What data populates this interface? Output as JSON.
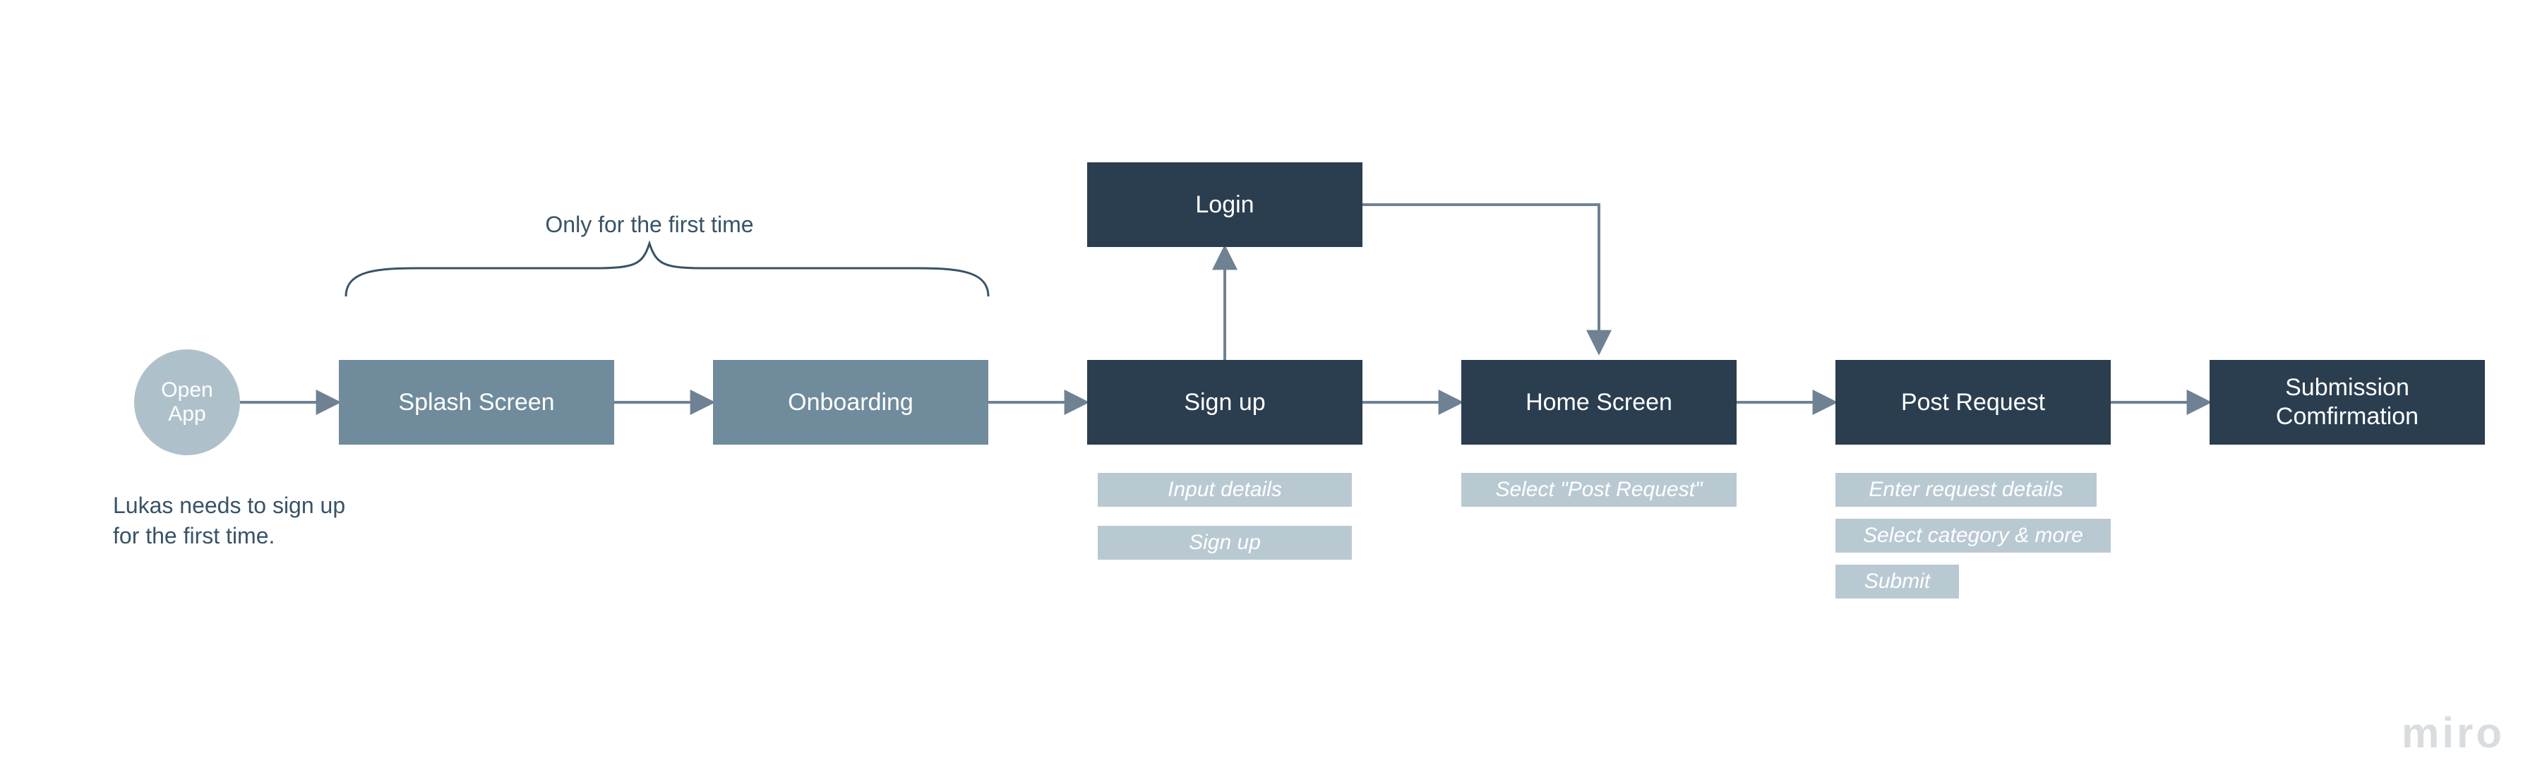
{
  "start": {
    "label": "Open\nApp"
  },
  "brace_label": "Only  for the first time",
  "annotation": "Lukas needs to sign up for the first time.",
  "nodes": {
    "splash": {
      "label": "Splash Screen"
    },
    "onboarding": {
      "label": "Onboarding"
    },
    "signup": {
      "label": "Sign up"
    },
    "login": {
      "label": "Login"
    },
    "home": {
      "label": "Home Screen"
    },
    "post": {
      "label": "Post Request"
    },
    "confirm": {
      "label": "Submission Comfirmation"
    }
  },
  "substeps": {
    "signup": [
      "Input details",
      "Sign up"
    ],
    "home": [
      "Select \"Post Request\""
    ],
    "post": [
      "Enter request details",
      "Select category & more",
      "Submit"
    ]
  },
  "brand": "miro",
  "colors": {
    "light_box": "#6f8b9c",
    "dark_box": "#2b3e50",
    "circle": "#aec1cb",
    "substep": "#b9c9d2",
    "text_muted": "#385366",
    "arrow": "#6f8294"
  }
}
